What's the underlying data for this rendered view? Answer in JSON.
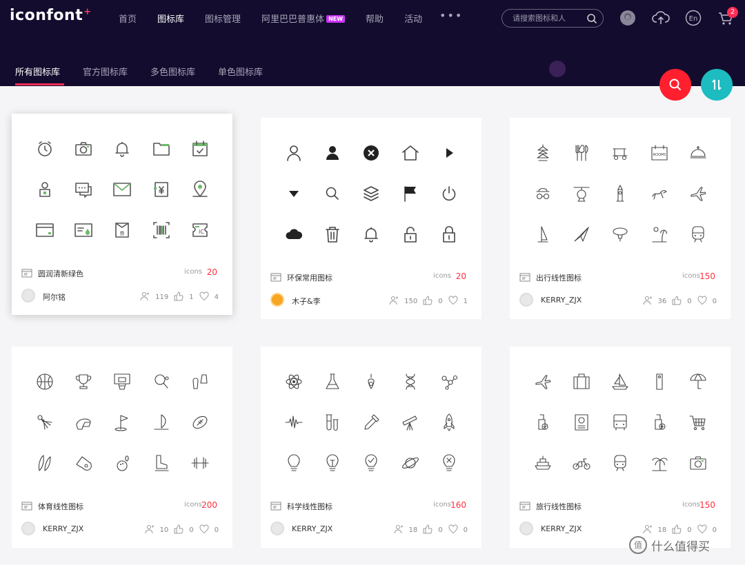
{
  "logo": {
    "text": "iconfont",
    "plus": "+"
  },
  "nav": [
    {
      "label": "首页",
      "active": false
    },
    {
      "label": "图标库",
      "active": true
    },
    {
      "label": "图标管理",
      "active": false
    },
    {
      "label": "阿里巴巴普惠体",
      "active": false,
      "badge": "NEW"
    },
    {
      "label": "帮助",
      "active": false
    },
    {
      "label": "活动",
      "active": false
    }
  ],
  "more": "•••",
  "search": {
    "placeholder": "请搜索图标和人"
  },
  "cart": {
    "count": "2"
  },
  "lang": "En",
  "subtabs": [
    {
      "label": "所有图标库",
      "active": true
    },
    {
      "label": "官方图标库",
      "active": false
    },
    {
      "label": "多色图标库",
      "active": false
    },
    {
      "label": "单色图标库",
      "active": false
    }
  ],
  "count_label": "icons",
  "cards": [
    {
      "title": "圆润清新绿色",
      "count": "20",
      "author": "阿尔铭",
      "avatar": "gray",
      "collects": "119",
      "likes": "1",
      "favs": "4",
      "style": "green",
      "icons": [
        "alarm-clock-icon",
        "camera-icon",
        "bell-icon",
        "folder-icon",
        "calendar-check-icon",
        "user-card-icon",
        "chat-icon",
        "mail-icon",
        "yen-receipt-icon",
        "location-pin-icon",
        "card-icon",
        "id-card-drop-icon",
        "coupon-icon",
        "barcode-icon",
        "ticket-icon"
      ]
    },
    {
      "title": "环保常用图标",
      "count": "20",
      "author": "木子&李",
      "avatar": "orange",
      "collects": "150",
      "likes": "0",
      "favs": "1",
      "style": "solid",
      "icons": [
        "user-outline-icon",
        "user-solid-icon",
        "close-circle-icon",
        "home-icon",
        "play-icon",
        "triangle-down-icon",
        "search-icon",
        "layers-icon",
        "flag-icon",
        "power-icon",
        "cloud-icon",
        "trash-icon",
        "bell-icon",
        "unlock-icon",
        "lock-icon"
      ]
    },
    {
      "title": "出行线性图标",
      "count": "150",
      "author": "KERRY_ZJX",
      "avatar": "gray",
      "collects": "36",
      "likes": "0",
      "favs": "0",
      "style": "line",
      "icons": [
        "pagoda-icon",
        "cutlery-icon",
        "golf-cart-icon",
        "rooms-sign-icon",
        "food-cloche-icon",
        "hat-glasses-icon",
        "helicopter-icon",
        "big-ben-icon",
        "dragon-icon",
        "airplane-icon",
        "sail-icon",
        "plane-fold-icon",
        "blimp-icon",
        "beach-icon",
        "train-icon"
      ]
    },
    {
      "title": "体育线性图标",
      "count": "200",
      "author": "KERRY_ZJX",
      "avatar": "gray",
      "collects": "10",
      "likes": "0",
      "favs": "0",
      "style": "line",
      "icons": [
        "basketball-icon",
        "trophy-icon",
        "hoop-icon",
        "ping-pong-icon",
        "flippers-icon",
        "shuttlecock-icon",
        "helmet-icon",
        "golf-flag-icon",
        "windsurf-icon",
        "football-icon",
        "surfboard-icon",
        "whistle-icon",
        "bowling-icon",
        "skate-boot-icon",
        "dumbbell-icon"
      ]
    },
    {
      "title": "科学线性图标",
      "count": "160",
      "author": "KERRY_ZJX",
      "avatar": "gray",
      "collects": "18",
      "likes": "0",
      "favs": "0",
      "style": "line",
      "icons": [
        "atom-icon",
        "flask-icon",
        "bulb-drop-icon",
        "dna-icon",
        "molecule-icon",
        "waveform-icon",
        "test-tubes-icon",
        "dropper-icon",
        "telescope-icon",
        "rocket-icon",
        "bulb-icon",
        "bulb-idea-icon",
        "bulb-check-icon",
        "planet-icon",
        "bulb-x-icon"
      ]
    },
    {
      "title": "旅行线性图标",
      "count": "150",
      "author": "KERRY_ZJX",
      "avatar": "gray",
      "collects": "18",
      "likes": "0",
      "favs": "0",
      "style": "line",
      "icons": [
        "airplane-icon",
        "suitcase-icon",
        "sailboat-icon",
        "luggage-tag-icon",
        "beach-umbrella-icon",
        "bag-check-icon",
        "passport-icon",
        "bus-icon",
        "bag-plus-icon",
        "cart-icon",
        "ship-icon",
        "motorbike-icon",
        "train-icon",
        "palm-tree-icon",
        "camera-icon"
      ]
    }
  ],
  "watermark": {
    "circle": "值",
    "text": "什么值得买"
  }
}
